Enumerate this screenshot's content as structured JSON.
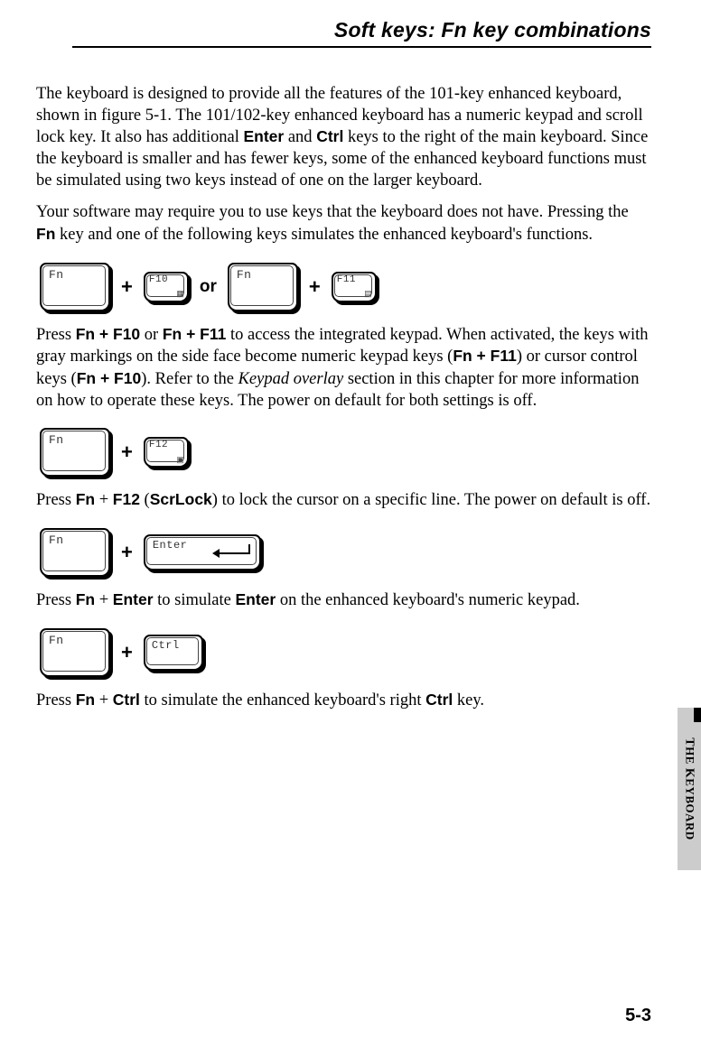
{
  "header": {
    "title": "Soft keys: Fn key combinations"
  },
  "para1": {
    "t1": "The keyboard is designed to provide all the features of the 101-key enhanced keyboard, shown in figure 5-1. The 101/102-key enhanced keyboard has a numeric keypad and scroll lock key. It also has additional ",
    "b1": "Enter",
    "t2": " and ",
    "b2": "Ctrl",
    "t3": " keys to the right of the main keyboard. Since the keyboard is smaller and has fewer keys, some of the enhanced keyboard functions must be simulated using two keys instead of one on the larger keyboard."
  },
  "para2": {
    "t1": "Your software may require you to use keys that the keyboard does not have. Pressing the ",
    "b1": "Fn",
    "t2": " key and one of the following keys simulates the enhanced keyboard's functions."
  },
  "row1": {
    "fn": "Fn",
    "plus": "+",
    "f10": "F10",
    "or": "or",
    "fn2": "Fn",
    "f11": "F11"
  },
  "para3": {
    "t1": "Press ",
    "b1": "Fn + F10",
    "t2": " or ",
    "b2": "Fn + F11",
    "t3": " to access the integrated keypad. When activated, the keys with gray markings on the side face become numeric keypad keys (",
    "b3": "Fn + F11",
    "t4": ") or cursor control keys (",
    "b4": "Fn + F10",
    "t5": "). Refer to the ",
    "i1": "Keypad overlay",
    "t6": " section in this chapter for more information on how to operate these keys. The power on default for both settings is off."
  },
  "row2": {
    "fn": "Fn",
    "plus": "+",
    "f12": "F12"
  },
  "para4": {
    "t1": "Press ",
    "b1": "Fn",
    "t2": " + ",
    "b2": "F12",
    "t3": " (",
    "b3": "ScrLock",
    "t4": ") to lock the cursor on a specific line. The power on default is off."
  },
  "row3": {
    "fn": "Fn",
    "plus": "+",
    "enter": "Enter"
  },
  "para5": {
    "t1": "Press ",
    "b1": "Fn",
    "t2": " + ",
    "b2": "Enter",
    "t3": " to simulate ",
    "b3": "Enter",
    "t4": " on the enhanced keyboard's numeric keypad."
  },
  "row4": {
    "fn": "Fn",
    "plus": "+",
    "ctrl": "Ctrl"
  },
  "para6": {
    "t1": "Press ",
    "b1": "Fn",
    "t2": " + ",
    "b2": "Ctrl",
    "t3": " to simulate the enhanced keyboard's right ",
    "b3": "Ctrl",
    "t4": " key."
  },
  "sidetab": {
    "t1": "T",
    "t2": "HE",
    "t3": " K",
    "t4": "EYBOARD"
  },
  "pagenum": "5-3"
}
